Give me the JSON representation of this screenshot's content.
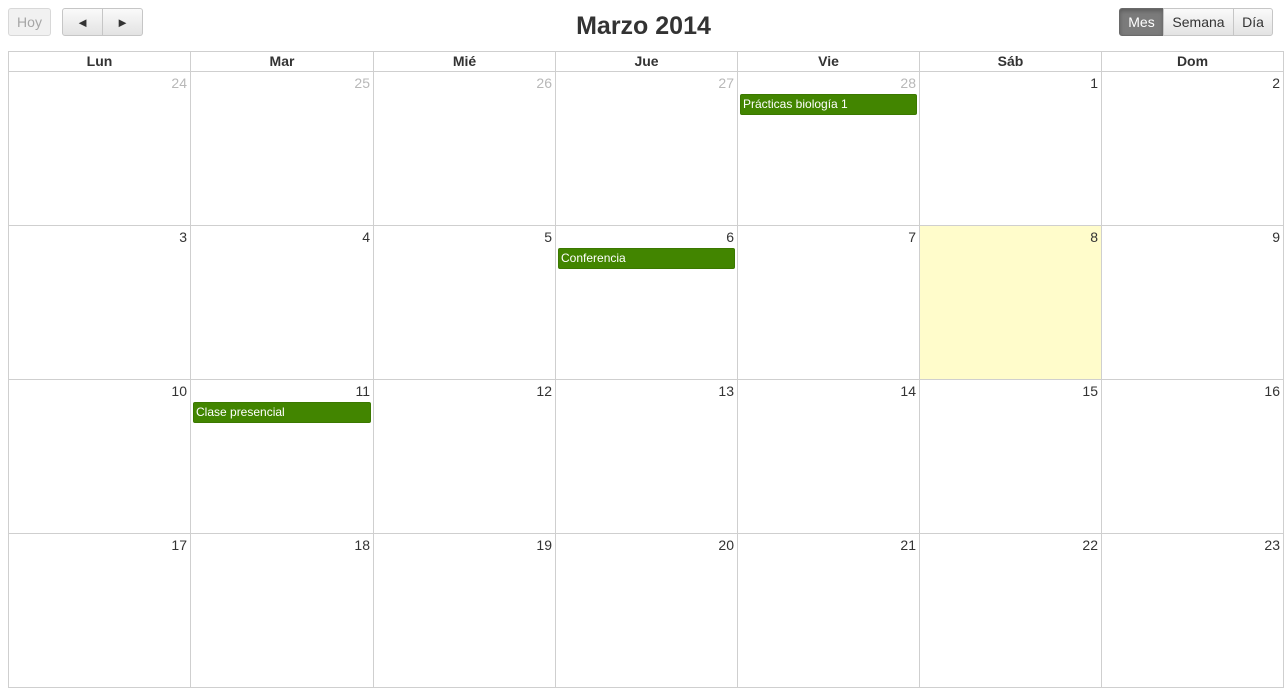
{
  "toolbar": {
    "today_label": "Hoy",
    "prev_label": "◄",
    "next_label": "►",
    "title": "Marzo 2014",
    "views": [
      "Mes",
      "Semana",
      "Día"
    ],
    "active_view": "Mes"
  },
  "weekdays": [
    "Lun",
    "Mar",
    "Mié",
    "Jue",
    "Vie",
    "Sáb",
    "Dom"
  ],
  "weeks": [
    [
      {
        "day": "24",
        "other": true
      },
      {
        "day": "25",
        "other": true
      },
      {
        "day": "26",
        "other": true
      },
      {
        "day": "27",
        "other": true
      },
      {
        "day": "28",
        "other": true,
        "event": "Prácticas biología 1"
      },
      {
        "day": "1"
      },
      {
        "day": "2"
      }
    ],
    [
      {
        "day": "3"
      },
      {
        "day": "4"
      },
      {
        "day": "5"
      },
      {
        "day": "6",
        "event": "Conferencia"
      },
      {
        "day": "7"
      },
      {
        "day": "8",
        "today": true
      },
      {
        "day": "9"
      }
    ],
    [
      {
        "day": "10"
      },
      {
        "day": "11",
        "event": "Clase presencial"
      },
      {
        "day": "12"
      },
      {
        "day": "13"
      },
      {
        "day": "14"
      },
      {
        "day": "15"
      },
      {
        "day": "16"
      }
    ],
    [
      {
        "day": "17"
      },
      {
        "day": "18"
      },
      {
        "day": "19"
      },
      {
        "day": "20"
      },
      {
        "day": "21"
      },
      {
        "day": "22"
      },
      {
        "day": "23"
      }
    ]
  ],
  "colors": {
    "event": "#428500",
    "today": "#fffccb",
    "active_view": "#7b7b7b"
  }
}
